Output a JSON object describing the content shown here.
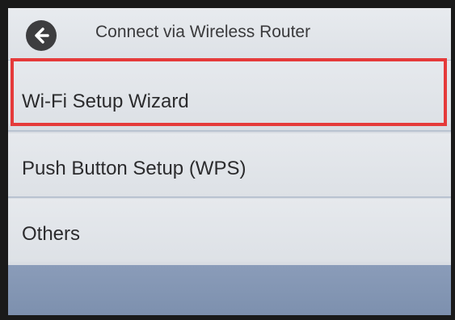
{
  "header": {
    "title": "Connect via Wireless Router",
    "back_icon": "arrow-left-icon"
  },
  "menu": {
    "items": [
      {
        "label": "Wi-Fi Setup Wizard",
        "highlighted": true
      },
      {
        "label": "Push Button Setup (WPS)",
        "highlighted": false
      },
      {
        "label": "Others",
        "highlighted": false
      }
    ]
  },
  "colors": {
    "highlight_border": "#e53a3a",
    "bottom_bar": "#8a9cb9",
    "screen_background": "#d9dde3"
  }
}
